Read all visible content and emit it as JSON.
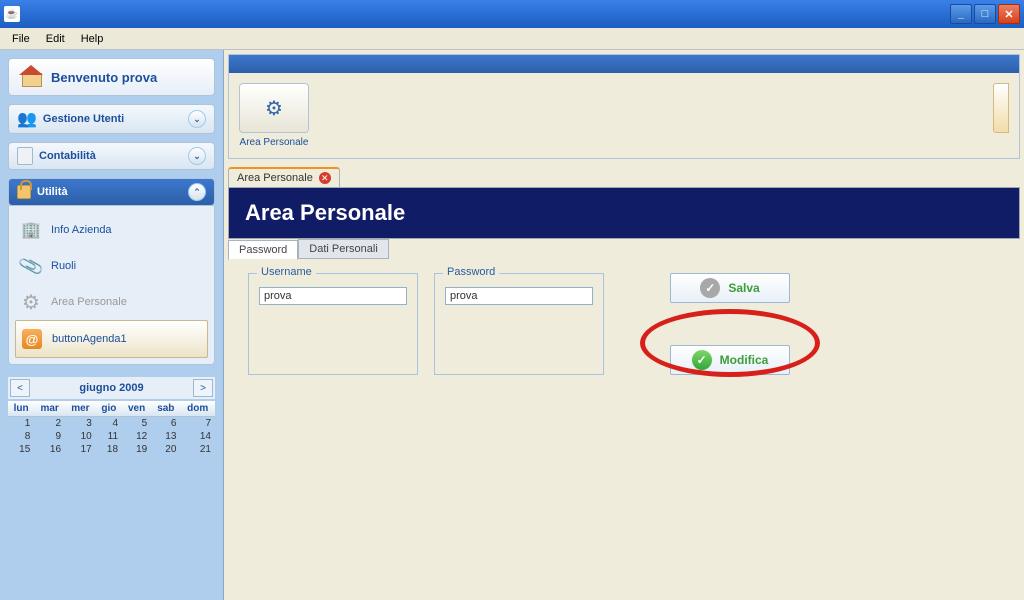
{
  "menubar": {
    "file": "File",
    "edit": "Edit",
    "help": "Help"
  },
  "sidebar": {
    "welcome": "Benvenuto prova",
    "gestione_utenti": "Gestione Utenti",
    "contabilita": "Contabilità",
    "utilita": "Utilità",
    "utilita_items": {
      "info_azienda": "Info Azienda",
      "ruoli": "Ruoli",
      "area_personale": "Area Personale",
      "button_agenda": "buttonAgenda1"
    }
  },
  "calendar": {
    "title": "giugno 2009",
    "days": [
      "lun",
      "mar",
      "mer",
      "gio",
      "ven",
      "sab",
      "dom"
    ],
    "rows": [
      [
        "1",
        "2",
        "3",
        "4",
        "5",
        "6",
        "7"
      ],
      [
        "8",
        "9",
        "10",
        "11",
        "12",
        "13",
        "14"
      ],
      [
        "15",
        "16",
        "17",
        "18",
        "19",
        "20",
        "21"
      ]
    ]
  },
  "toolbar": {
    "area_personale": "Area Personale"
  },
  "doc_tab": {
    "label": "Area Personale"
  },
  "page": {
    "title": "Area Personale",
    "tabs": {
      "password": "Password",
      "dati_personali": "Dati Personali"
    }
  },
  "form": {
    "username_label": "Username",
    "username_value": "prova",
    "password_label": "Password",
    "password_value": "prova"
  },
  "buttons": {
    "salva": "Salva",
    "modifica": "Modifica"
  }
}
